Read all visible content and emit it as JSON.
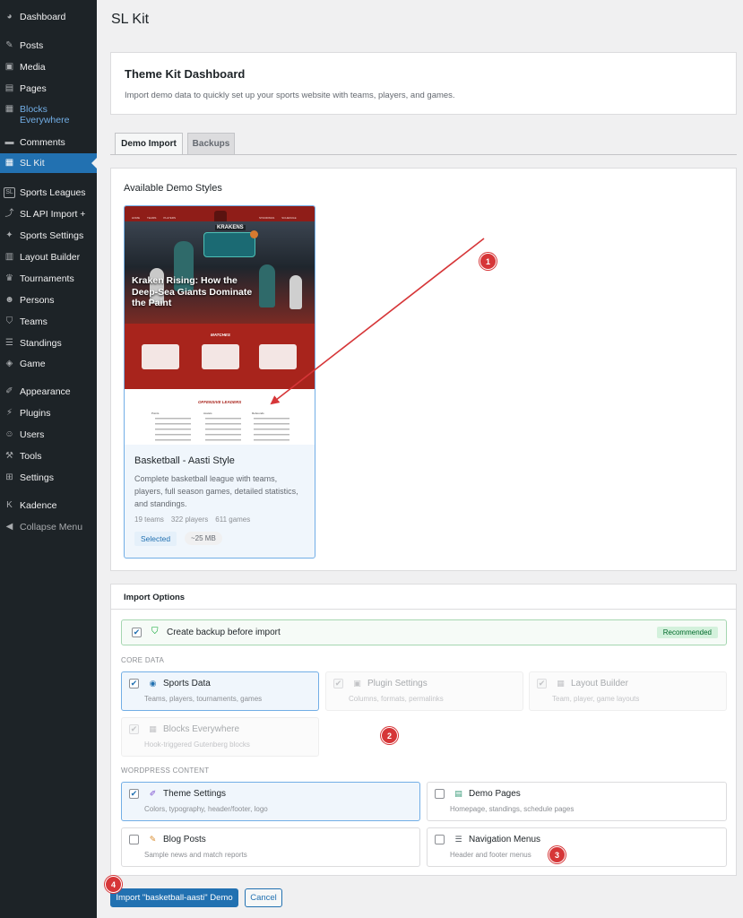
{
  "sidebar": {
    "items": [
      {
        "label": "Dashboard",
        "icon": "dashboard-icon",
        "glyph": "◕"
      },
      {
        "label": "Posts",
        "icon": "pin-icon",
        "glyph": "✎"
      },
      {
        "label": "Media",
        "icon": "media-icon",
        "glyph": "▣"
      },
      {
        "label": "Pages",
        "icon": "page-icon",
        "glyph": "▤"
      },
      {
        "label": "Blocks Everywhere",
        "icon": "blocks-icon",
        "glyph": "▦"
      },
      {
        "label": "Comments",
        "icon": "comment-icon",
        "glyph": "▬"
      },
      {
        "label": "SL Kit",
        "icon": "kit-icon",
        "glyph": "▦"
      },
      {
        "label": "Sports Leagues",
        "icon": "sl-icon",
        "glyph": "SL"
      },
      {
        "label": "SL API Import +",
        "icon": "import-icon",
        "glyph": "⤴"
      },
      {
        "label": "Sports Settings",
        "icon": "wrench-icon",
        "glyph": "✦"
      },
      {
        "label": "Layout Builder",
        "icon": "layout-icon",
        "glyph": "▥"
      },
      {
        "label": "Tournaments",
        "icon": "trophy-icon",
        "glyph": "♛"
      },
      {
        "label": "Persons",
        "icon": "persons-icon",
        "glyph": "☻"
      },
      {
        "label": "Teams",
        "icon": "shield-icon",
        "glyph": "⛉"
      },
      {
        "label": "Standings",
        "icon": "list-icon",
        "glyph": "☰"
      },
      {
        "label": "Game",
        "icon": "game-icon",
        "glyph": "◈"
      },
      {
        "label": "Appearance",
        "icon": "brush-icon",
        "glyph": "✐"
      },
      {
        "label": "Plugins",
        "icon": "plugin-icon",
        "glyph": "⚡"
      },
      {
        "label": "Users",
        "icon": "user-icon",
        "glyph": "☺"
      },
      {
        "label": "Tools",
        "icon": "tool-icon",
        "glyph": "⚒"
      },
      {
        "label": "Settings",
        "icon": "settings-icon",
        "glyph": "⊞"
      },
      {
        "label": "Kadence",
        "icon": "kadence-icon",
        "glyph": "K"
      },
      {
        "label": "Collapse Menu",
        "icon": "collapse-icon",
        "glyph": "◀"
      }
    ]
  },
  "page": {
    "title": "SL Kit",
    "dashboard_title": "Theme Kit Dashboard",
    "dashboard_subtitle": "Import demo data to quickly set up your sports website with teams, players, and games."
  },
  "tabs": [
    {
      "label": "Demo Import",
      "active": true
    },
    {
      "label": "Backups",
      "active": false
    }
  ],
  "demo": {
    "heading": "Available Demo Styles",
    "preview": {
      "site_title": "KRAKENS",
      "nav": [
        "HOME",
        "TEAMS",
        "PLAYERS",
        "STANDINGS",
        "SCHEDULE"
      ],
      "hero_line1": "Kraken Rising: How the",
      "hero_line2": "Deep-Sea Giants Dominate",
      "hero_line3": "the Paint",
      "matches_label": "MATCHES",
      "leaders_label": "OFFENSIVE LEADERS",
      "columns": [
        "Points",
        "Assists",
        "Rebounds"
      ]
    },
    "card_title": "Basketball - Aasti Style",
    "card_desc": "Complete basketball league with teams, players, full season games, detailed statistics, and standings.",
    "stats": [
      "19 teams",
      "322 players",
      "611 games"
    ],
    "selected_label": "Selected",
    "size_label": "~25 MB"
  },
  "import": {
    "heading": "Import Options",
    "backup_label": "Create backup before import",
    "recommended_label": "Recommended",
    "core_section": "CORE DATA",
    "wp_section": "WORDPRESS CONTENT",
    "options": {
      "sports_data": {
        "label": "Sports Data",
        "desc": "Teams, players, tournaments, games"
      },
      "plugin_settings": {
        "label": "Plugin Settings",
        "desc": "Columns, formats, permalinks"
      },
      "layout_builder": {
        "label": "Layout Builder",
        "desc": "Team, player, game layouts"
      },
      "blocks_everywhere": {
        "label": "Blocks Everywhere",
        "desc": "Hook-triggered Gutenberg blocks"
      },
      "theme_settings": {
        "label": "Theme Settings",
        "desc": "Colors, typography, header/footer, logo"
      },
      "demo_pages": {
        "label": "Demo Pages",
        "desc": "Homepage, standings, schedule pages"
      },
      "blog_posts": {
        "label": "Blog Posts",
        "desc": "Sample news and match reports"
      },
      "nav_menus": {
        "label": "Navigation Menus",
        "desc": "Header and footer menus"
      }
    },
    "import_button": "Import \"basketball-aasti\" Demo",
    "cancel_button": "Cancel"
  },
  "annotations": [
    "1",
    "2",
    "3",
    "4"
  ],
  "colors": {
    "sidebar": "#1d2327",
    "wp_blue": "#2271b1",
    "preview_red": "#a8241c",
    "badge_red": "#d63638",
    "recommended_green": "#00a32a"
  }
}
